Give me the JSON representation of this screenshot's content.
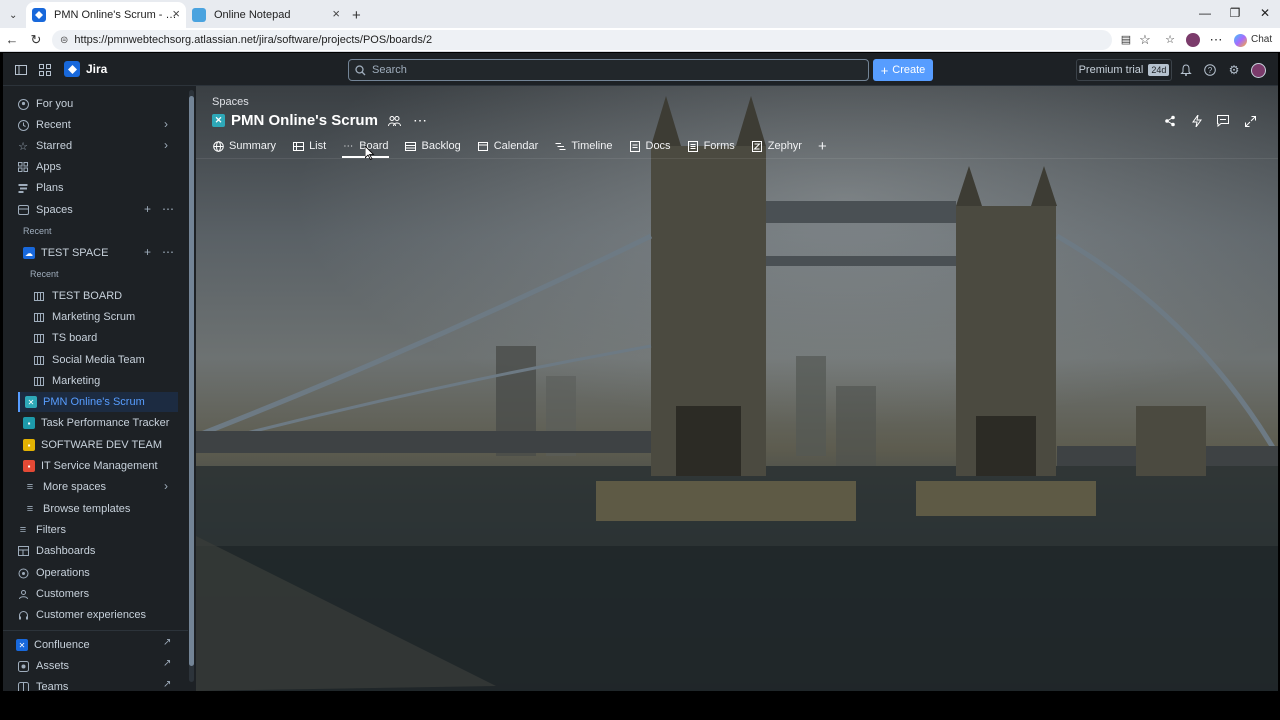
{
  "browser": {
    "tabs": [
      {
        "title": "PMN Online's Scrum - Backlog - J",
        "active": true,
        "icon": "jira-icon"
      },
      {
        "title": "Online Notepad",
        "active": false,
        "icon": "notepad-icon"
      }
    ],
    "url": "https://pmnwebtechsorg.atlassian.net/jira/software/projects/POS/boards/2",
    "chat_label": "Chat"
  },
  "topnav": {
    "app_name": "Jira",
    "search_placeholder": "Search",
    "create_label": "Create",
    "premium_label": "Premium trial",
    "premium_badge": "24d"
  },
  "sidebar": {
    "items": [
      {
        "label": "For you",
        "icon": "user-circle-icon"
      },
      {
        "label": "Recent",
        "icon": "clock-icon"
      },
      {
        "label": "Starred",
        "icon": "star-icon"
      },
      {
        "label": "Apps",
        "icon": "apps-icon"
      },
      {
        "label": "Plans",
        "icon": "plans-icon"
      },
      {
        "label": "Spaces",
        "icon": "spaces-icon"
      }
    ],
    "recent_label": "Recent",
    "test_space": "TEST SPACE",
    "recent_sub_label": "Recent",
    "boards": [
      "TEST BOARD",
      "Marketing Scrum",
      "TS board",
      "Social Media Team",
      "Marketing"
    ],
    "projects": [
      {
        "label": "PMN Online's Scrum",
        "color": "#2ea8b8"
      },
      {
        "label": "Task Performance Tracker",
        "color": "#1d9aaa"
      },
      {
        "label": "SOFTWARE DEV TEAM",
        "color": "#e2b203"
      },
      {
        "label": "IT Service Management",
        "color": "#e34935"
      }
    ],
    "more_spaces": "More spaces",
    "browse_templates": "Browse templates",
    "bottom_items": [
      {
        "label": "Filters",
        "icon": "filter-icon"
      },
      {
        "label": "Dashboards",
        "icon": "dashboard-icon"
      },
      {
        "label": "Operations",
        "icon": "operations-icon"
      },
      {
        "label": "Customers",
        "icon": "customers-icon"
      },
      {
        "label": "Customer experiences",
        "icon": "headset-icon"
      }
    ],
    "external_items": [
      "Confluence",
      "Assets",
      "Teams"
    ]
  },
  "main": {
    "breadcrumb": "Spaces",
    "title": "PMN Online's Scrum",
    "tabs": [
      {
        "label": "Summary",
        "icon": "globe-icon"
      },
      {
        "label": "List",
        "icon": "list-icon"
      },
      {
        "label": "Board",
        "icon": "board-icon",
        "active": true
      },
      {
        "label": "Backlog",
        "icon": "backlog-icon"
      },
      {
        "label": "Calendar",
        "icon": "calendar-icon"
      },
      {
        "label": "Timeline",
        "icon": "timeline-icon"
      },
      {
        "label": "Docs",
        "icon": "docs-icon"
      },
      {
        "label": "Forms",
        "icon": "forms-icon"
      },
      {
        "label": "Zephyr",
        "icon": "zephyr-icon"
      }
    ]
  }
}
